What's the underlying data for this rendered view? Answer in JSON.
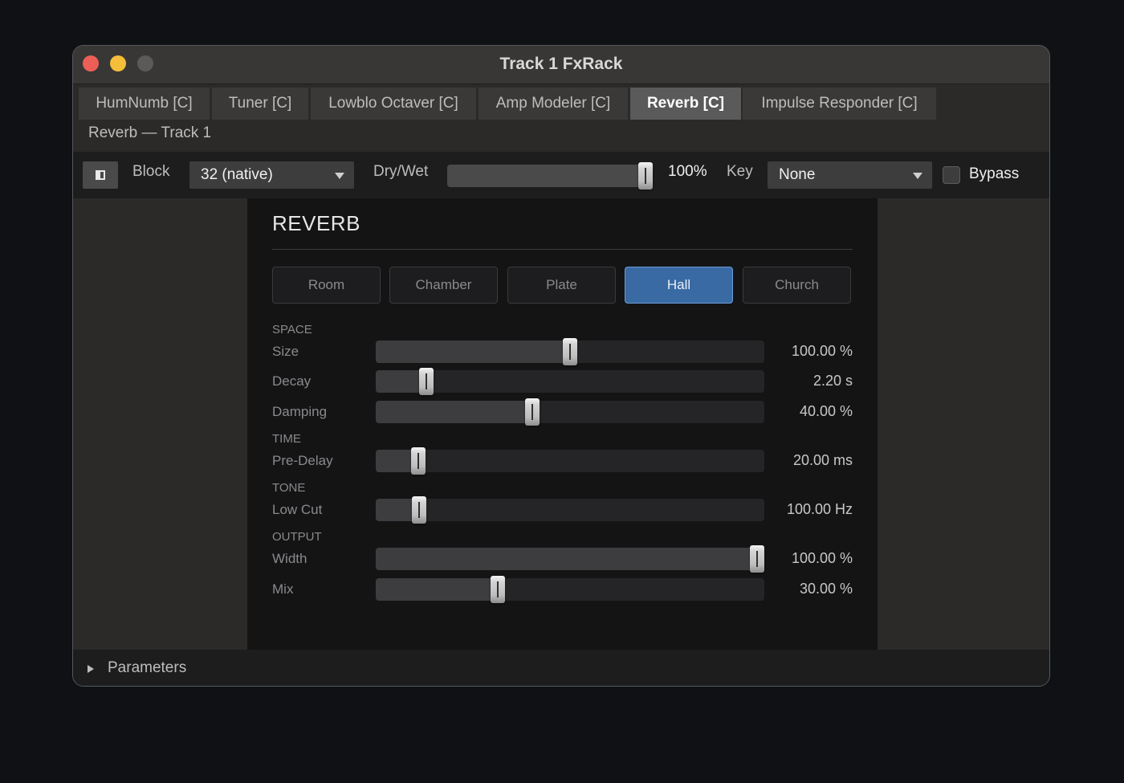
{
  "window": {
    "title": "Track 1 FxRack"
  },
  "tabs": [
    {
      "label": "HumNumb [C]",
      "active": false
    },
    {
      "label": "Tuner [C]",
      "active": false
    },
    {
      "label": "Lowblo Octaver [C]",
      "active": false
    },
    {
      "label": "Amp Modeler [C]",
      "active": false
    },
    {
      "label": "Reverb [C]",
      "active": true
    },
    {
      "label": "Impulse Responder [C]",
      "active": false
    }
  ],
  "subtitle": "Reverb — Track 1",
  "toolbar": {
    "block_label": "Block",
    "block_value": "32 (native)",
    "drywet_label": "Dry/Wet",
    "drywet_fraction": 1.0,
    "drywet_value": "100%",
    "key_label": "Key",
    "key_value": "None",
    "bypass_label": "Bypass",
    "bypass_checked": false
  },
  "panel": {
    "title": "REVERB",
    "presets": [
      {
        "label": "Room",
        "active": false
      },
      {
        "label": "Chamber",
        "active": false
      },
      {
        "label": "Plate",
        "active": false
      },
      {
        "label": "Hall",
        "active": true
      },
      {
        "label": "Church",
        "active": false
      }
    ],
    "sections": {
      "space": "SPACE",
      "time": "TIME",
      "tone": "TONE",
      "output": "OUTPUT"
    },
    "params": {
      "size": {
        "label": "Size",
        "value": "100.00 %",
        "fraction": 0.5
      },
      "decay": {
        "label": "Decay",
        "value": "2.20 s",
        "fraction": 0.115
      },
      "damping": {
        "label": "Damping",
        "value": "40.00 %",
        "fraction": 0.4
      },
      "predelay": {
        "label": "Pre-Delay",
        "value": "20.00 ms",
        "fraction": 0.095
      },
      "lowcut": {
        "label": "Low Cut",
        "value": "100.00 Hz",
        "fraction": 0.096
      },
      "width": {
        "label": "Width",
        "value": "100.00 %",
        "fraction": 1.0
      },
      "mix": {
        "label": "Mix",
        "value": "30.00 %",
        "fraction": 0.307
      }
    }
  },
  "footer": {
    "label": "Parameters"
  },
  "colors": {
    "accent": "#3a6aa3",
    "close": "#ec5f57",
    "minimize": "#f4bd3a",
    "maximize": "#5a5a5a"
  }
}
